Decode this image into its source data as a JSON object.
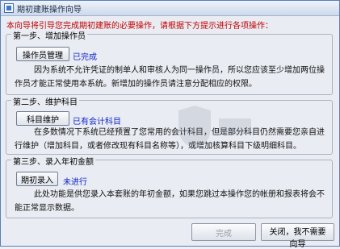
{
  "window": {
    "title": "期初建账操作向导"
  },
  "intro": "本向导将引导您完成期初建账的必要操作，请根据下方提示进行各项操作：",
  "steps": [
    {
      "title": "第一步、增加操作员",
      "button": "操作员管理",
      "status": "已完成",
      "description": "因为系统不允许凭证的制单人和审核人为同一操作员，所以您应该至少增加两位操作员才能正常使用本系统。新增加的操作员请注意分配相应的权限。"
    },
    {
      "title": "第二步、维护科目",
      "button": "科目维护",
      "status": "已有会计科目",
      "description": "在多数情况下系统已经预置了您常用的会计科目，但是部分科目仍然需要您亲自进行维护（增加科目，或者修改现有科目名称等），或增加核算科目下级明细科目。"
    },
    {
      "title": "第三步、录入年初金额",
      "button": "期初录入",
      "status": "未进行",
      "description": "此处功能是供您录入本套账的年初金额，如果您跳过本操作您的帐册和报表将会不能正常显示数据。"
    }
  ],
  "footer": {
    "finish_label": "完成",
    "close_label": "关闭，我不需要向导"
  },
  "colors": {
    "status": "#1226c8",
    "intro": "#c00000"
  }
}
